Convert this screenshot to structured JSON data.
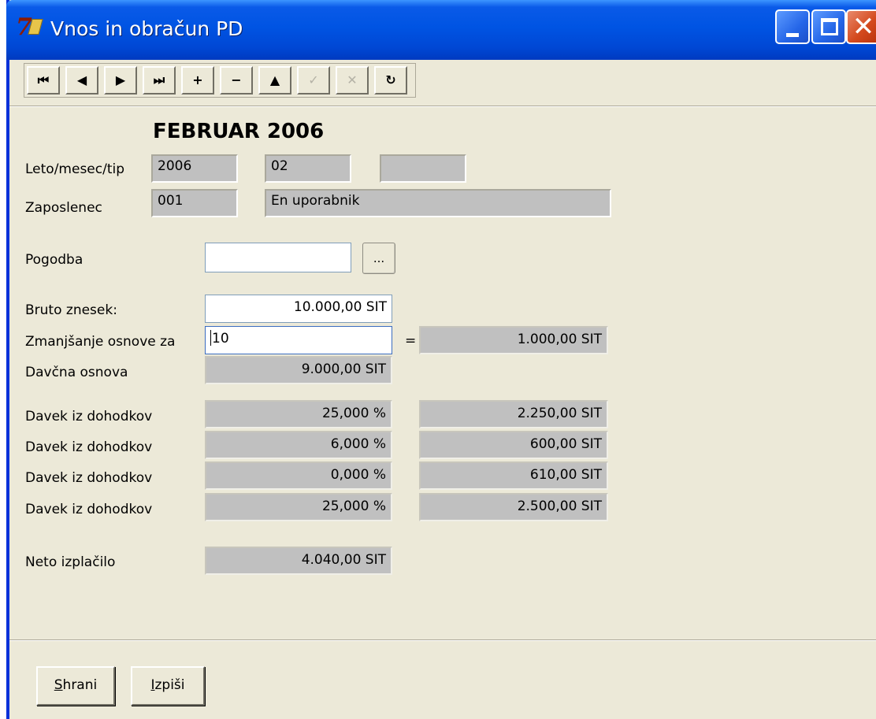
{
  "window": {
    "title": "Vnos in obračun PD",
    "app_icon": "7",
    "controls": [
      "minimize-icon",
      "maximize-icon",
      "close-icon"
    ]
  },
  "toolbar": {
    "buttons": [
      {
        "name": "first-record",
        "glyph": "⏮",
        "enabled": true
      },
      {
        "name": "prior-record",
        "glyph": "◀",
        "enabled": true
      },
      {
        "name": "next-record",
        "glyph": "▶",
        "enabled": true
      },
      {
        "name": "last-record",
        "glyph": "⏭",
        "enabled": true
      },
      {
        "name": "insert-record",
        "glyph": "+",
        "enabled": true
      },
      {
        "name": "delete-record",
        "glyph": "−",
        "enabled": true
      },
      {
        "name": "edit-record",
        "glyph": "▲",
        "enabled": true
      },
      {
        "name": "post-edit",
        "glyph": "✓",
        "enabled": false
      },
      {
        "name": "cancel-edit",
        "glyph": "✕",
        "enabled": false
      },
      {
        "name": "refresh-data",
        "glyph": "↻",
        "enabled": true
      }
    ]
  },
  "header": {
    "month_title": "FEBRUAR 2006"
  },
  "form": {
    "period_label": "Leto/mesec/tip",
    "year": "2006",
    "month": "02",
    "type": "",
    "employee_label": "Zaposlenec",
    "employee_code": "001",
    "employee_name": "En uporabnik",
    "contract_label": "Pogodba",
    "contract_value": "",
    "contract_button": "...",
    "gross_label": "Bruto znesek:",
    "gross_value": "10.000,00 SIT",
    "reduction_label": "Zmanjšanje osnove za",
    "reduction_value": "10",
    "equals": "=",
    "reduction_amount": "1.000,00 SIT",
    "tax_base_label": "Davčna osnova",
    "tax_base_value": "9.000,00 SIT",
    "taxes": [
      {
        "label": "Davek iz dohodkov",
        "rate": "25,000 %",
        "amount": "2.250,00 SIT"
      },
      {
        "label": "Davek iz dohodkov",
        "rate": "6,000 %",
        "amount": "600,00 SIT"
      },
      {
        "label": "Davek iz dohodkov",
        "rate": "0,000 %",
        "amount": "610,00 SIT"
      },
      {
        "label": "Davek iz dohodkov",
        "rate": "25,000 %",
        "amount": "2.500,00 SIT"
      }
    ],
    "net_label": "Neto izplačilo",
    "net_value": "4.040,00 SIT"
  },
  "actions": {
    "save_hotkey": "S",
    "save_rest": "hrani",
    "print_hotkey": "I",
    "print_rest": "zpiši"
  }
}
